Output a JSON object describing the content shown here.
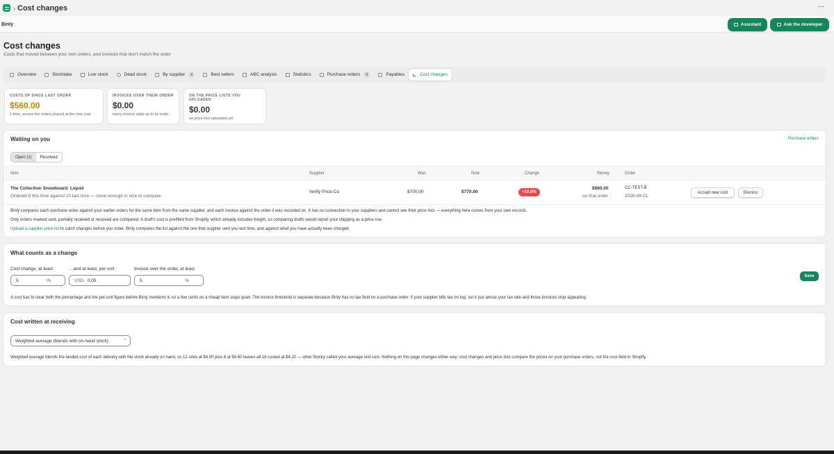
{
  "window": {
    "title": "Cost changes",
    "more_label": "···"
  },
  "app": {
    "brand": "Binly"
  },
  "header_buttons": {
    "assistant": "Assistant",
    "developer": "Ask the developer"
  },
  "page": {
    "title": "Cost changes",
    "subtitle": "Costs that moved between your own orders, and invoices that don't match the order"
  },
  "tabs": [
    {
      "label": "Overview",
      "icon": "grid-icon"
    },
    {
      "label": "Stocktake",
      "icon": "list-icon"
    },
    {
      "label": "Low stock",
      "icon": "warning-icon"
    },
    {
      "label": "Dead stock",
      "icon": "clock-icon"
    },
    {
      "label": "By supplier",
      "icon": "building-icon",
      "badge": "2"
    },
    {
      "label": "Best sellers",
      "icon": "chart-icon"
    },
    {
      "label": "ABC analysis",
      "icon": "tag-icon"
    },
    {
      "label": "Statistics",
      "icon": "bar-chart-icon"
    },
    {
      "label": "Purchase orders",
      "icon": "document-icon",
      "badge": "5"
    },
    {
      "label": "Payables",
      "icon": "wallet-icon"
    },
    {
      "label": "Cost changes",
      "icon": "trend-icon",
      "active": true
    }
  ],
  "stats": [
    {
      "label": "Costs up since last order",
      "value": "$560.00",
      "note": "1 item, across the orders placed at the new cost",
      "color": "#b98900"
    },
    {
      "label": "Invoices over their order",
      "value": "$0.00",
      "note": "every invoice adds up to its order",
      "color": "#303030"
    },
    {
      "label": "On the price lists you uploaded",
      "value": "$0.00",
      "note": "no price lists uploaded yet",
      "color": "#303030"
    }
  ],
  "waiting": {
    "title": "Waiting on you",
    "link": "Purchase orders",
    "seg_open": "Open (1)",
    "seg_resolved": "Resolved",
    "columns": {
      "item": "Item",
      "supplier": "Supplier",
      "was": "Was",
      "now": "Now",
      "change": "Change",
      "money": "Money",
      "order": "Order"
    },
    "row": {
      "item": "The Collection Snowboard: Liquid",
      "detail": "Ordered 8 this time against 10 last time — close enough in size to compare.",
      "supplier": "Verify Price Co",
      "was": "$700.00",
      "now": "$770.00",
      "change": "+10.0%",
      "money": "$560.00",
      "money_note": "on that order",
      "order_id": "CC-TEST-B",
      "order_date": "2026-08-01",
      "accept": "Accept new cost",
      "dismiss": "Dismiss"
    },
    "para1": "Binly compares each purchase order against your earlier orders for the same item from the same supplier, and each invoice against the order it was recorded on. It has no connection to your suppliers and cannot see their price lists — everything here comes from your own records.",
    "para2": "Only orders marked sent, partially received or received are compared. A draft's cost is prefilled from Shopify, which already includes freight, so comparing drafts would report your shipping as a price rise.",
    "para3_link": "Upload a supplier price list",
    "para3": " to catch changes before you order. Binly compares the list against the one that supplier sent you last time, and against what you have actually been charged."
  },
  "threshold": {
    "title": "What counts as a change",
    "label1": "Cost change, at least",
    "value1": "5",
    "suffix1": "%",
    "label2": "…and at least, per unit",
    "prefix2": "USD",
    "value2": "0,05",
    "label3": "Invoice over the order, at least",
    "value3": "5",
    "suffix3": "%",
    "save": "Save",
    "note": "A cost has to clear both the percentage and the per-unit figure before Binly mentions it, so a few cents on a cheap item stays quiet. The invoice threshold is separate because Binly has no tax field on a purchase order: if your supplier bills tax on top, set it just above your tax rate and those invoices stop appearing."
  },
  "receiving": {
    "title": "Cost written at receiving",
    "select_value": "Weighted average (blends with on-hand stock)",
    "note": "Weighted average blends the landed cost of each delivery with the stock already on hand, so 12 units at $4.00 plus 6 at $4.60 leaves all 18 costed at $4.20 — what Stocky called your average unit cost. Nothing on this page changes either way: cost changes and price lists compare the prices on your purchase orders, not the cost field in Shopify."
  }
}
